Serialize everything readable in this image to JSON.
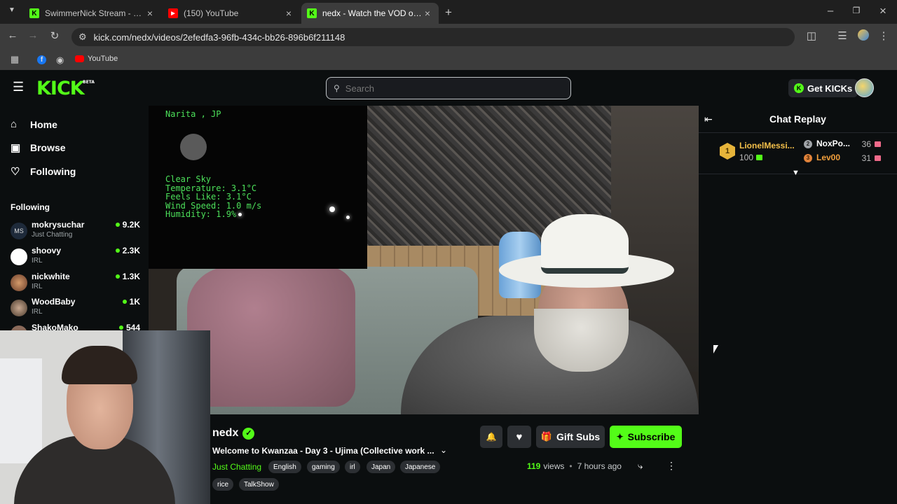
{
  "browser": {
    "tabs": [
      {
        "title": "SwimmerNick Stream - Watch Li",
        "active": false
      },
      {
        "title": "(150) YouTube",
        "active": false
      },
      {
        "title": "nedx - Watch the VOD on Kick",
        "active": true
      }
    ],
    "url": "kick.com/nedx/videos/2efedfa3-96fb-434c-bb26-896b6f211148",
    "bookmarks": [
      {
        "label": "YouTube"
      }
    ]
  },
  "header": {
    "logo": "KICK",
    "logo_badge": "BETA",
    "search_placeholder": "Search",
    "get_kicks_label": "Get KICKs"
  },
  "sidebar": {
    "nav": [
      {
        "label": "Home",
        "icon": "home-icon"
      },
      {
        "label": "Browse",
        "icon": "browse-icon"
      },
      {
        "label": "Following",
        "icon": "heart-icon"
      }
    ],
    "following_heading": "Following",
    "following": [
      {
        "name": "mokrysuchar",
        "category": "Just Chatting",
        "viewers": "9.2K",
        "avatar_text": "MS"
      },
      {
        "name": "shoovy",
        "category": "IRL",
        "viewers": "2.3K",
        "avatar_text": ""
      },
      {
        "name": "nickwhite",
        "category": "IRL",
        "viewers": "1.3K",
        "avatar_text": ""
      },
      {
        "name": "WoodBaby",
        "category": "IRL",
        "viewers": "1K",
        "avatar_text": ""
      },
      {
        "name": "ShakoMako",
        "category": "",
        "viewers": "544",
        "avatar_text": ""
      }
    ]
  },
  "video_overlay": {
    "location": "Narita , JP",
    "weather": [
      "Clear Sky",
      "Temperature: 3.1°C",
      "Feels Like: 3.1°C",
      "Wind Speed: 1.0 m/s",
      "Humidity: 1.9%"
    ]
  },
  "stream": {
    "channel": "nedx",
    "title": "Welcome to Kwanzaa - Day 3 - Ujima (Collective work ...",
    "category": "Just Chatting",
    "tags": [
      "English",
      "gaming",
      "irl",
      "Japan",
      "Japanese",
      "rice",
      "TalkShow"
    ],
    "views_count": "119",
    "views_label": "views",
    "separator": "•",
    "time_ago": "7 hours ago",
    "gift_subs_label": "Gift Subs",
    "subscribe_label": "Subscribe"
  },
  "chat": {
    "title": "Chat Replay",
    "leaderboard": [
      {
        "rank": "1",
        "name": "LionelMessi...",
        "value": "100"
      },
      {
        "rank": "2",
        "name": "NoxPo...",
        "value": "36"
      },
      {
        "rank": "3",
        "name": "Lev00",
        "value": "31"
      }
    ]
  },
  "colors": {
    "brand": "#53fc18",
    "background": "#0b0e0f",
    "gold": "#f5c04a",
    "bronze": "#f3a03c"
  }
}
